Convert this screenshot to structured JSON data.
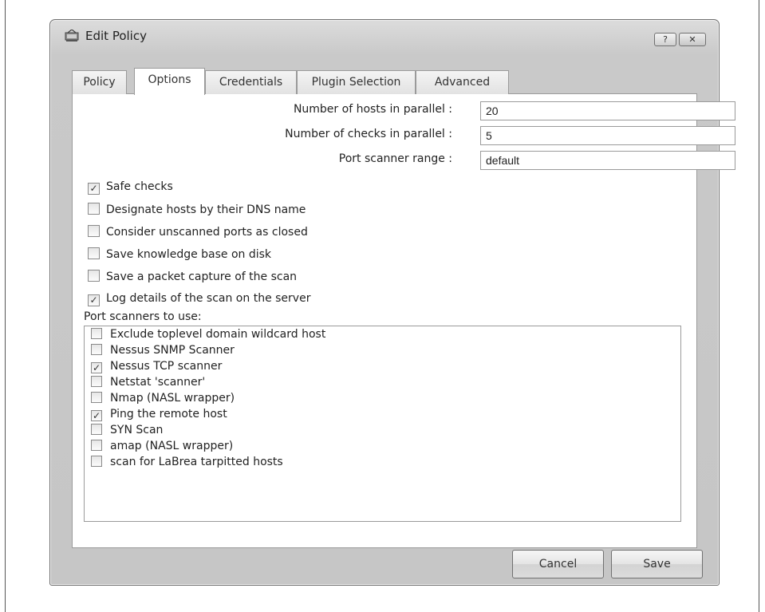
{
  "window": {
    "title": "Edit Policy",
    "help_label": "?",
    "close_label": "✕"
  },
  "tabs": [
    {
      "label": "Policy"
    },
    {
      "label": "Options"
    },
    {
      "label": "Credentials"
    },
    {
      "label": "Plugin Selection"
    },
    {
      "label": "Advanced"
    }
  ],
  "active_tab": "Options",
  "fields": [
    {
      "label": "Number of hosts in parallel :",
      "value": "20"
    },
    {
      "label": "Number of checks in parallel :",
      "value": "5"
    },
    {
      "label": "Port scanner range :",
      "value": "default"
    }
  ],
  "options": [
    {
      "label": "Safe checks",
      "checked": true
    },
    {
      "label": "Designate hosts by their DNS name",
      "checked": false
    },
    {
      "label": "Consider unscanned ports as closed",
      "checked": false
    },
    {
      "label": "Save knowledge base on disk",
      "checked": false
    },
    {
      "label": "Save a packet capture of the scan",
      "checked": false
    },
    {
      "label": "Log details of the scan on the server",
      "checked": true
    }
  ],
  "scanners_label": "Port scanners to use:",
  "scanners": [
    {
      "label": "Exclude toplevel domain wildcard host",
      "checked": false
    },
    {
      "label": "Nessus SNMP Scanner",
      "checked": false
    },
    {
      "label": "Nessus TCP scanner",
      "checked": true
    },
    {
      "label": "Netstat 'scanner'",
      "checked": false
    },
    {
      "label": "Nmap (NASL wrapper)",
      "checked": false
    },
    {
      "label": "Ping the remote host",
      "checked": true
    },
    {
      "label": "SYN Scan",
      "checked": false
    },
    {
      "label": "amap (NASL wrapper)",
      "checked": false
    },
    {
      "label": "scan for LaBrea tarpitted hosts",
      "checked": false
    }
  ],
  "buttons": {
    "cancel": "Cancel",
    "save": "Save"
  },
  "colors": {
    "window_bg": "#c9c9c9",
    "panel_bg": "#ffffff",
    "border": "#9a9a9a"
  }
}
